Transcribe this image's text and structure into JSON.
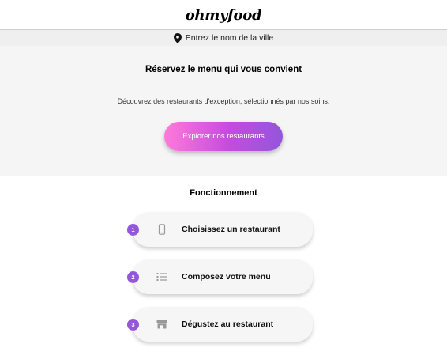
{
  "header": {
    "logo": "ohmyfood"
  },
  "location": {
    "icon": "map-marker-icon",
    "text": "Entrez le nom de la ville"
  },
  "hero": {
    "title": "Réservez le menu qui vous convient",
    "subtitle": "Découvrez des restaurants d'exception, sélectionnés par nos soins.",
    "cta_label": "Explorer nos restaurants"
  },
  "how": {
    "title": "Fonctionnement",
    "steps": [
      {
        "number": "1",
        "icon": "mobile-phone-icon",
        "label": "Choisissez un restaurant"
      },
      {
        "number": "2",
        "icon": "list-icon",
        "label": "Composez votre menu"
      },
      {
        "number": "3",
        "icon": "store-icon",
        "label": "Dégustez au restaurant"
      }
    ]
  },
  "colors": {
    "accent": "#9356dc",
    "gradient_start": "#ff79da",
    "hero_bg": "#f5f5f5"
  }
}
